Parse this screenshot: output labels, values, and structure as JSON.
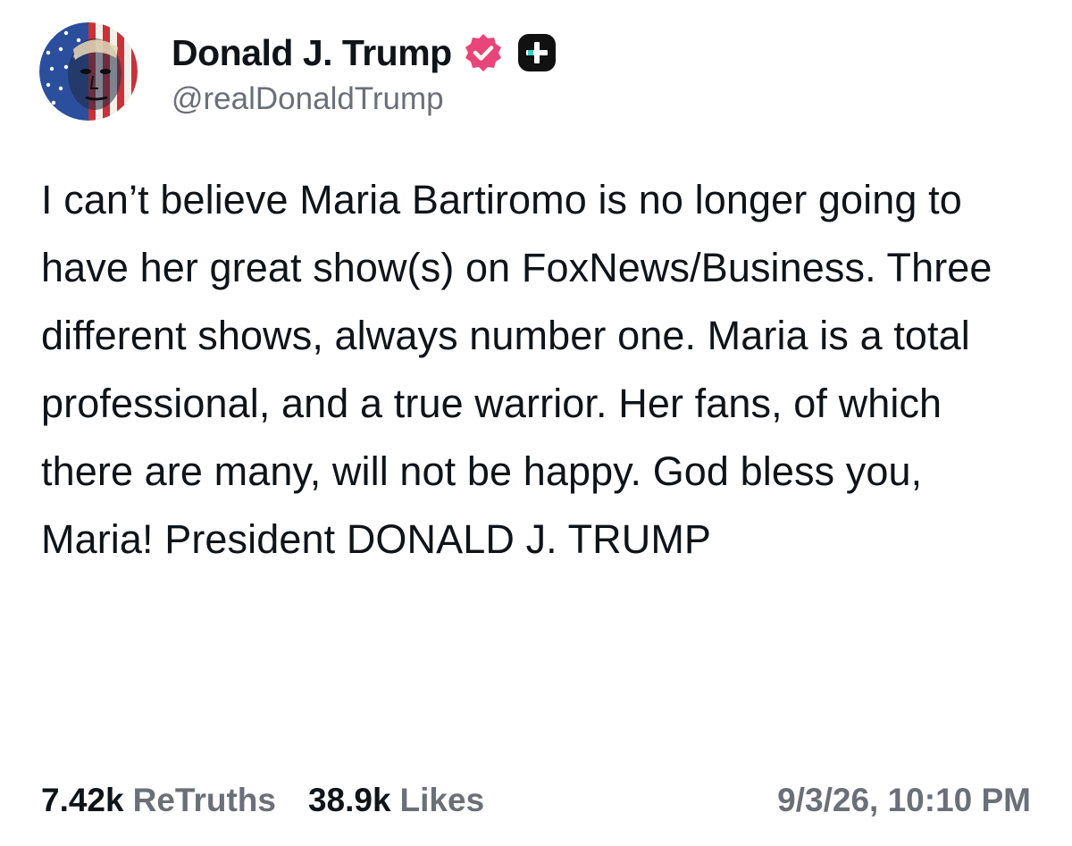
{
  "author": {
    "display_name": "Donald J. Trump",
    "handle": "@realDonaldTrump",
    "verified_icon": "verified-badge-icon",
    "verified_color": "#e8457a",
    "badge_icon": "plus-badge-icon",
    "badge_color": "#111111"
  },
  "post": {
    "text": "I can’t believe Maria Bartiromo is no longer going to have her great show(s) on FoxNews/Business. Three different shows, always number one. Maria is a total professional, and a true warrior. Her fans, of which there are many, will not be happy. God bless you, Maria! President DONALD J. TRUMP"
  },
  "stats": {
    "retruths_count": "7.42k",
    "retruths_label": "ReTruths",
    "likes_count": "38.9k",
    "likes_label": "Likes"
  },
  "timestamp": "9/3/26, 10:10 PM"
}
